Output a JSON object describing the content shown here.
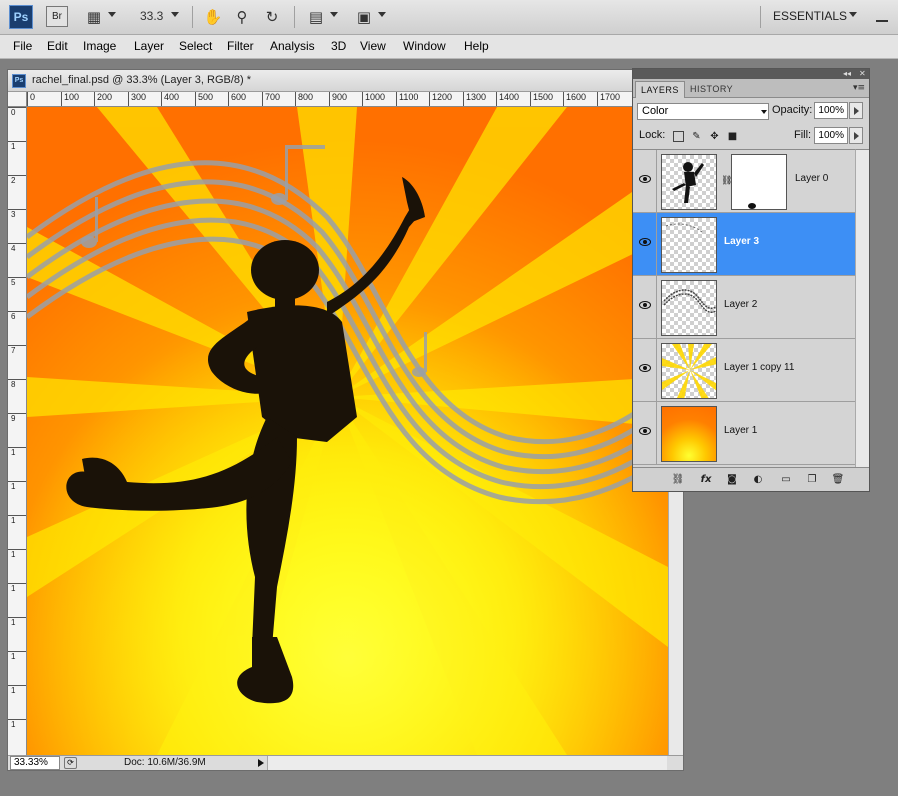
{
  "app": {
    "logo": "Ps",
    "bridge": "Br",
    "zoom": "33.3",
    "workspace": "ESSENTIALS",
    "icons": [
      "film-strip-icon",
      "hand-icon",
      "zoom-icon",
      "rotate-view-icon",
      "arrange-documents-icon",
      "screen-mode-icon"
    ]
  },
  "menu": [
    "File",
    "Edit",
    "Image",
    "Layer",
    "Select",
    "Filter",
    "Analysis",
    "3D",
    "View",
    "Window",
    "Help"
  ],
  "document": {
    "icon_label": "Ps",
    "title": "rachel_final.psd @ 33.3% (Layer 3, RGB/8) *",
    "ruler_h": [
      "0",
      "100",
      "200",
      "300",
      "400",
      "500",
      "600",
      "700",
      "800",
      "900",
      "1000",
      "1100",
      "1200",
      "1300",
      "1400",
      "1500",
      "1600",
      "1700"
    ],
    "ruler_v": [
      "0",
      "1",
      "2",
      "3",
      "4",
      "5",
      "6",
      "7",
      "8",
      "9",
      "1",
      "1",
      "1",
      "1",
      "1",
      "1",
      "1",
      "1",
      "1"
    ],
    "status_zoom": "33.33%",
    "status_doc": "Doc: 10.6M/36.9M"
  },
  "layers_panel": {
    "tabs": [
      "LAYERS",
      "HISTORY"
    ],
    "blend_mode": "Color",
    "opacity_label": "Opacity:",
    "opacity": "100%",
    "lock_label": "Lock:",
    "fill_label": "Fill:",
    "fill": "100%",
    "layers": [
      {
        "name": "Layer 0",
        "selected": false
      },
      {
        "name": "Layer 3",
        "selected": true
      },
      {
        "name": "Layer 2",
        "selected": false
      },
      {
        "name": "Layer 1 copy 11",
        "selected": false
      },
      {
        "name": "Layer 1",
        "selected": false
      }
    ],
    "bottom_icons": [
      "link-layers-icon",
      "fx-icon",
      "layer-mask-icon",
      "adjustment-layer-icon",
      "new-group-icon",
      "new-layer-icon",
      "trash-icon"
    ]
  },
  "colors": {
    "selection": "#3d8ff5",
    "canvas_orange": "#ff7a00",
    "canvas_yellow": "#ffee00"
  }
}
